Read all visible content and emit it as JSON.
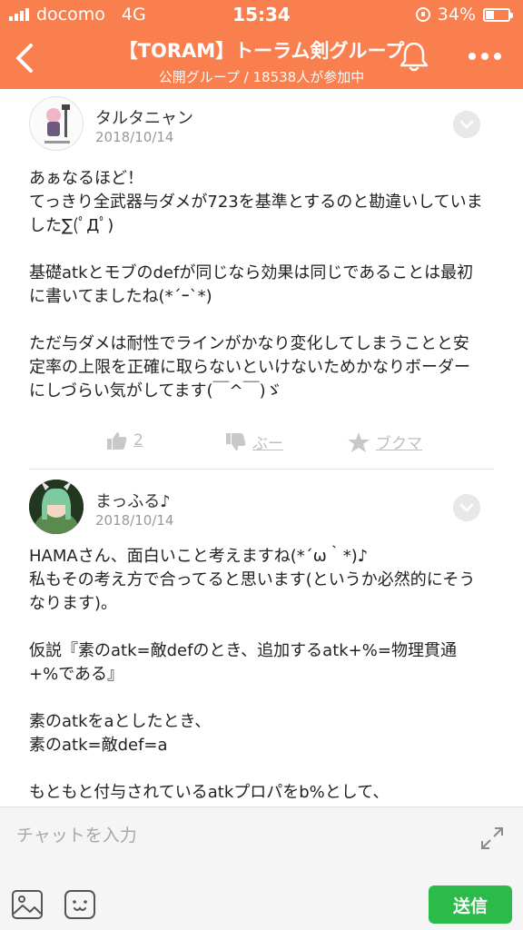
{
  "status_bar": {
    "carrier": "docomo",
    "network": "4G",
    "time": "15:34",
    "battery": "34%"
  },
  "header": {
    "title": "【TORAM】トーラム剣グループ",
    "subtitle": "公開グループ / 18538人が参加中",
    "icons": {
      "back": "chevron-left-icon",
      "bell": "bell-icon",
      "more": "more-icon"
    }
  },
  "posts": [
    {
      "author": "タルタニャン",
      "date": "2018/10/14",
      "body": "あぁなるほど！\nてっきり全武器与ダメが723を基準とするのと勘違いしていました∑(ﾟДﾟ)\n\n基礎atkとモブのdefが同じなら効果は同じであることは最初に書いてましたね(*´ｰ`*)\n\nただ与ダメは耐性でラインがかなり変化してしまうことと安定率の上限を正確に取らないといけないためかなりボーダーにしづらい気がしてます(￣^￣)ゞ",
      "actions": {
        "like_count": "2",
        "dislike_label": "ぶー",
        "bookmark_label": "ブクマ"
      }
    },
    {
      "author": "まっふる♪",
      "date": "2018/10/14",
      "body": "HAMAさん、面白いこと考えますね(*´ω｀*)♪\n私もその考え方で合ってると思います(というか必然的にそうなります)。\n\n仮説『素のatk=敵defのとき、追加するatk+%=物理貫通+%である』\n\n素のatkをaとしたとき、\n素のatk=敵def=a\n\nもともと付与されているatkプロパをb%として、"
    }
  ],
  "composer": {
    "placeholder": "チャットを入力",
    "send_label": "送信"
  },
  "colors": {
    "header": "#fa7f4f",
    "send": "#2cbb4a"
  }
}
